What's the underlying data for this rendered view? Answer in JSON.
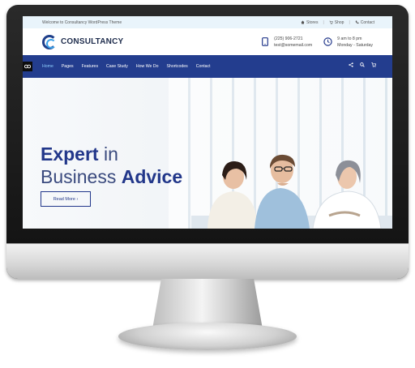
{
  "topbar": {
    "welcome": "Welcome to Consultancy WordPress Theme",
    "links": [
      {
        "icon": "home-icon",
        "label": "Stores"
      },
      {
        "icon": "cart-icon",
        "label": "Shop"
      },
      {
        "icon": "phone-icon",
        "label": "Contact"
      }
    ]
  },
  "header": {
    "logo_text": "CONSULTANCY",
    "phone": "(225) 906-2721",
    "email": "test@somemail.com",
    "hours_line1": "9 am to 8 pm",
    "hours_line2": "Monday - Saturday"
  },
  "nav": {
    "items": [
      {
        "label": "Home",
        "active": true
      },
      {
        "label": "Pages",
        "active": false
      },
      {
        "label": "Features",
        "active": false
      },
      {
        "label": "Case Study",
        "active": false
      },
      {
        "label": "How We Do",
        "active": false
      },
      {
        "label": "Shortcodes",
        "active": false
      },
      {
        "label": "Contact",
        "active": false
      }
    ],
    "right_icons": [
      "share-icon",
      "search-icon",
      "cart-icon"
    ]
  },
  "hero": {
    "line1_bold": "Expert",
    "line1_light": " in",
    "line2_light": "Business ",
    "line2_bold": "Advice",
    "button_label": "Read More ›"
  },
  "colors": {
    "nav_bg": "#233d8e",
    "brand_dark": "#1f2d4d",
    "brand_blue": "#22378a",
    "topbar_bg": "#e9f4fb",
    "accent": "#3aa0e8"
  }
}
